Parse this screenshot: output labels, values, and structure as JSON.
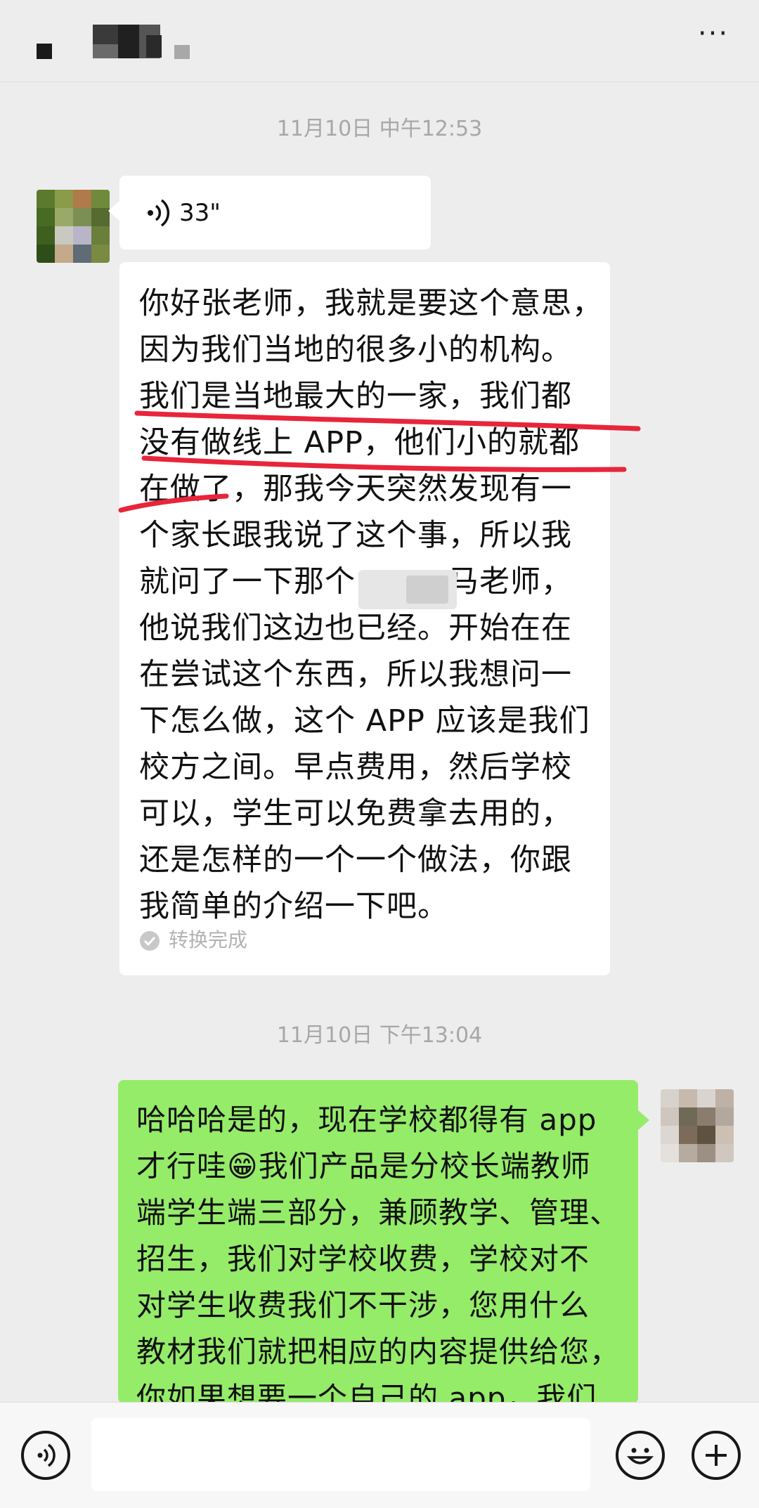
{
  "header": {
    "title": "",
    "more_icon": "more-icon",
    "more_glyph": "···"
  },
  "timestamps": [
    "11月10日 中午12:53",
    "11月10日 下午13:04"
  ],
  "voice_message": {
    "icon": "voice-wave-icon",
    "duration": "33\""
  },
  "transcribed_message": {
    "lines": [
      "你好张老师，我就是要这个意思，",
      "因为我们当地的很多小的机构。",
      "我们是当地最大的一家，我们都",
      "没有做线上 APP，他们小的就都",
      "在做了，那我今天突然发现有一",
      "个家长跟我说了这个事，所以我",
      "就问了一下那个　　　马老师，",
      "他说我们这边也已经。开始在在",
      "在尝试这个东西，所以我想问一",
      "下怎么做，这个 APP 应该是我们",
      "校方之间。早点费用，然后学校",
      "可以，学生可以免费拿去用的，",
      "还是怎样的一个一个做法，你跟",
      "我简单的介绍一下吧。"
    ],
    "status": "转换完成"
  },
  "reply_message": {
    "lines": [
      "哈哈哈是的，现在学校都得有 app",
      "才行哇😁我们产品是分校长端教师",
      "端学生端三部分，兼顾教学、管理、",
      "招生，我们对学校收费，学校对不",
      "对学生收费我们不干涉，您用什么",
      "教材我们就把相应的内容提供给您，",
      "你如果想要一个自己的 app，我们"
    ]
  },
  "input_bar": {
    "voice_icon": "voice-input-icon",
    "emoji_icon": "emoji-icon",
    "add_icon": "add-icon",
    "text_value": ""
  },
  "colors": {
    "background": "#ededed",
    "bubble_received": "#ffffff",
    "bubble_sent": "#95ec69",
    "annotation_red": "#e8253a"
  }
}
